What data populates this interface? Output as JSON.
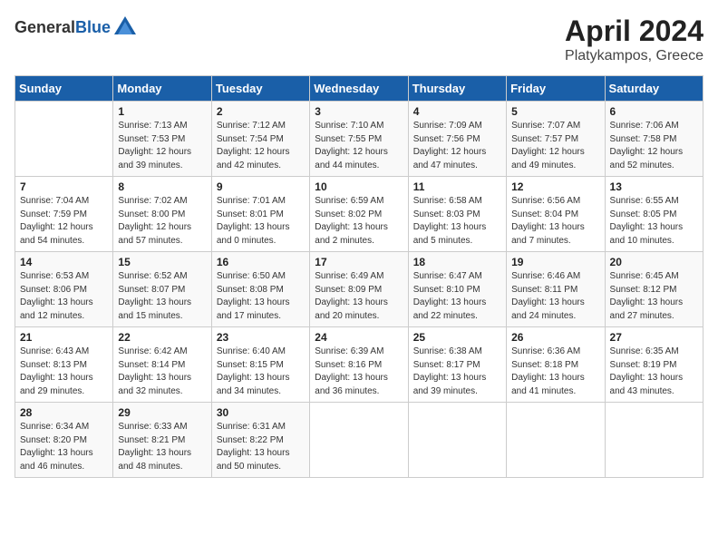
{
  "header": {
    "logo_general": "General",
    "logo_blue": "Blue",
    "title": "April 2024",
    "subtitle": "Platykampos, Greece"
  },
  "columns": [
    "Sunday",
    "Monday",
    "Tuesday",
    "Wednesday",
    "Thursday",
    "Friday",
    "Saturday"
  ],
  "weeks": [
    [
      {
        "day": "",
        "info": ""
      },
      {
        "day": "1",
        "info": "Sunrise: 7:13 AM\nSunset: 7:53 PM\nDaylight: 12 hours\nand 39 minutes."
      },
      {
        "day": "2",
        "info": "Sunrise: 7:12 AM\nSunset: 7:54 PM\nDaylight: 12 hours\nand 42 minutes."
      },
      {
        "day": "3",
        "info": "Sunrise: 7:10 AM\nSunset: 7:55 PM\nDaylight: 12 hours\nand 44 minutes."
      },
      {
        "day": "4",
        "info": "Sunrise: 7:09 AM\nSunset: 7:56 PM\nDaylight: 12 hours\nand 47 minutes."
      },
      {
        "day": "5",
        "info": "Sunrise: 7:07 AM\nSunset: 7:57 PM\nDaylight: 12 hours\nand 49 minutes."
      },
      {
        "day": "6",
        "info": "Sunrise: 7:06 AM\nSunset: 7:58 PM\nDaylight: 12 hours\nand 52 minutes."
      }
    ],
    [
      {
        "day": "7",
        "info": "Sunrise: 7:04 AM\nSunset: 7:59 PM\nDaylight: 12 hours\nand 54 minutes."
      },
      {
        "day": "8",
        "info": "Sunrise: 7:02 AM\nSunset: 8:00 PM\nDaylight: 12 hours\nand 57 minutes."
      },
      {
        "day": "9",
        "info": "Sunrise: 7:01 AM\nSunset: 8:01 PM\nDaylight: 13 hours\nand 0 minutes."
      },
      {
        "day": "10",
        "info": "Sunrise: 6:59 AM\nSunset: 8:02 PM\nDaylight: 13 hours\nand 2 minutes."
      },
      {
        "day": "11",
        "info": "Sunrise: 6:58 AM\nSunset: 8:03 PM\nDaylight: 13 hours\nand 5 minutes."
      },
      {
        "day": "12",
        "info": "Sunrise: 6:56 AM\nSunset: 8:04 PM\nDaylight: 13 hours\nand 7 minutes."
      },
      {
        "day": "13",
        "info": "Sunrise: 6:55 AM\nSunset: 8:05 PM\nDaylight: 13 hours\nand 10 minutes."
      }
    ],
    [
      {
        "day": "14",
        "info": "Sunrise: 6:53 AM\nSunset: 8:06 PM\nDaylight: 13 hours\nand 12 minutes."
      },
      {
        "day": "15",
        "info": "Sunrise: 6:52 AM\nSunset: 8:07 PM\nDaylight: 13 hours\nand 15 minutes."
      },
      {
        "day": "16",
        "info": "Sunrise: 6:50 AM\nSunset: 8:08 PM\nDaylight: 13 hours\nand 17 minutes."
      },
      {
        "day": "17",
        "info": "Sunrise: 6:49 AM\nSunset: 8:09 PM\nDaylight: 13 hours\nand 20 minutes."
      },
      {
        "day": "18",
        "info": "Sunrise: 6:47 AM\nSunset: 8:10 PM\nDaylight: 13 hours\nand 22 minutes."
      },
      {
        "day": "19",
        "info": "Sunrise: 6:46 AM\nSunset: 8:11 PM\nDaylight: 13 hours\nand 24 minutes."
      },
      {
        "day": "20",
        "info": "Sunrise: 6:45 AM\nSunset: 8:12 PM\nDaylight: 13 hours\nand 27 minutes."
      }
    ],
    [
      {
        "day": "21",
        "info": "Sunrise: 6:43 AM\nSunset: 8:13 PM\nDaylight: 13 hours\nand 29 minutes."
      },
      {
        "day": "22",
        "info": "Sunrise: 6:42 AM\nSunset: 8:14 PM\nDaylight: 13 hours\nand 32 minutes."
      },
      {
        "day": "23",
        "info": "Sunrise: 6:40 AM\nSunset: 8:15 PM\nDaylight: 13 hours\nand 34 minutes."
      },
      {
        "day": "24",
        "info": "Sunrise: 6:39 AM\nSunset: 8:16 PM\nDaylight: 13 hours\nand 36 minutes."
      },
      {
        "day": "25",
        "info": "Sunrise: 6:38 AM\nSunset: 8:17 PM\nDaylight: 13 hours\nand 39 minutes."
      },
      {
        "day": "26",
        "info": "Sunrise: 6:36 AM\nSunset: 8:18 PM\nDaylight: 13 hours\nand 41 minutes."
      },
      {
        "day": "27",
        "info": "Sunrise: 6:35 AM\nSunset: 8:19 PM\nDaylight: 13 hours\nand 43 minutes."
      }
    ],
    [
      {
        "day": "28",
        "info": "Sunrise: 6:34 AM\nSunset: 8:20 PM\nDaylight: 13 hours\nand 46 minutes."
      },
      {
        "day": "29",
        "info": "Sunrise: 6:33 AM\nSunset: 8:21 PM\nDaylight: 13 hours\nand 48 minutes."
      },
      {
        "day": "30",
        "info": "Sunrise: 6:31 AM\nSunset: 8:22 PM\nDaylight: 13 hours\nand 50 minutes."
      },
      {
        "day": "",
        "info": ""
      },
      {
        "day": "",
        "info": ""
      },
      {
        "day": "",
        "info": ""
      },
      {
        "day": "",
        "info": ""
      }
    ]
  ]
}
